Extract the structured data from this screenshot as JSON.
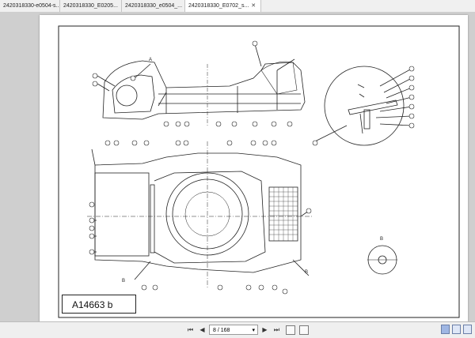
{
  "tabs": [
    {
      "label": "2420318330-e0504-s...",
      "active": false
    },
    {
      "label": "2420318330_E0205...",
      "active": false
    },
    {
      "label": "2420318330_e0504_...",
      "active": false
    },
    {
      "label": "2420318330_E0702_s...",
      "active": true
    }
  ],
  "document": {
    "drawing_label": "A14663 b",
    "view_label_detail": "B",
    "view_label_a": "A",
    "callout_b": "B"
  },
  "statusbar": {
    "page_indicator": "8 / 168",
    "first_icon": "first-page-icon",
    "prev_icon": "prev-page-icon",
    "next_icon": "next-page-icon",
    "last_icon": "last-page-icon"
  },
  "colors": {
    "line": "#222222",
    "page": "#ffffff",
    "viewer": "#cfcfcf",
    "accent": "#9fb6e3"
  }
}
